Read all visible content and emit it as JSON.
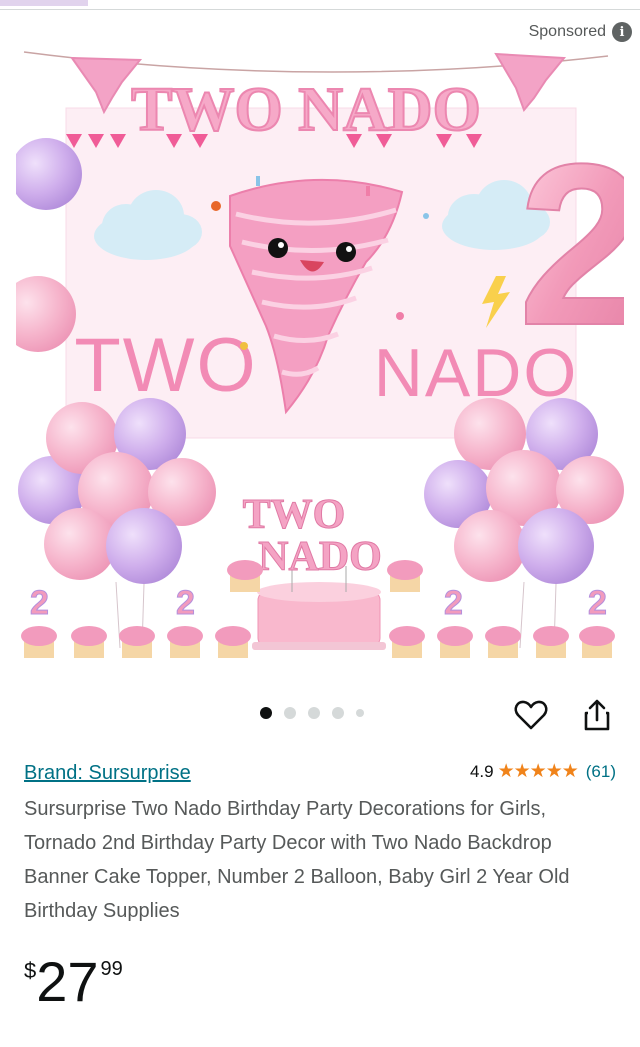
{
  "sponsored": {
    "label": "Sponsored",
    "icon": "info-icon"
  },
  "image": {
    "banner_text": "TWO NADO",
    "backdrop_word_left": "TWO",
    "backdrop_word_right": "NADO",
    "topper_line1": "TWO",
    "topper_line2": "NADO",
    "number_balloon": "2"
  },
  "carousel": {
    "count": 5,
    "active_index": 0
  },
  "actions": {
    "wishlist_icon": "heart-icon",
    "share_icon": "share-icon"
  },
  "product": {
    "brand": "Brand: Sursurprise",
    "rating": "4.9",
    "stars": 4.9,
    "review_count": "(61)",
    "title": "Sursurprise Two Nado Birthday Party Decorations for Girls, Tornado 2nd Birthday Party Decor with Two Nado Backdrop Banner Cake Topper, Number 2 Balloon, Baby Girl 2 Year Old Birthday Supplies",
    "price_symbol": "$",
    "price_whole": "27",
    "price_fraction": "99"
  },
  "colors": {
    "link": "#007185",
    "star": "#f0831a",
    "pink": "#f4a3c2",
    "lilac": "#c9a7e6"
  }
}
